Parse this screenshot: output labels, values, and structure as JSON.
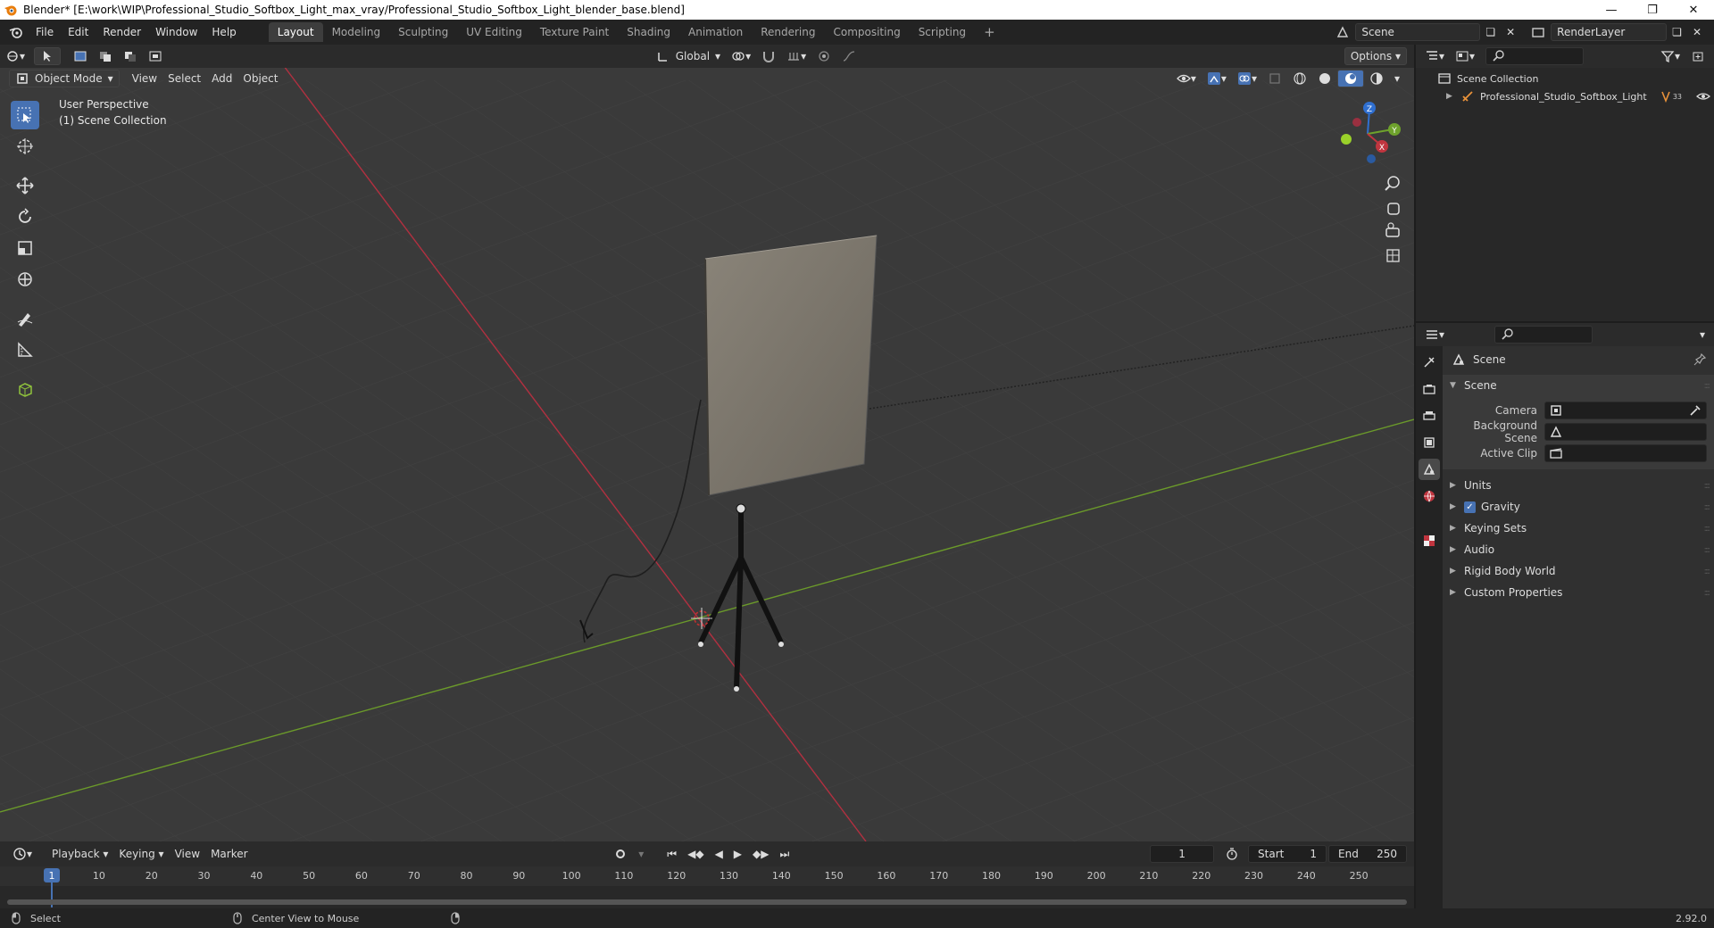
{
  "window": {
    "title": "Blender* [E:\\work\\WIP\\Professional_Studio_Softbox_Light_max_vray/Professional_Studio_Softbox_Light_blender_base.blend]"
  },
  "menu": [
    "File",
    "Edit",
    "Render",
    "Window",
    "Help"
  ],
  "workspaces": [
    {
      "label": "Layout",
      "active": true
    },
    {
      "label": "Modeling"
    },
    {
      "label": "Sculpting"
    },
    {
      "label": "UV Editing"
    },
    {
      "label": "Texture Paint"
    },
    {
      "label": "Shading"
    },
    {
      "label": "Animation"
    },
    {
      "label": "Rendering"
    },
    {
      "label": "Compositing"
    },
    {
      "label": "Scripting"
    }
  ],
  "scene_selector": {
    "value": "Scene"
  },
  "renderlayer_selector": {
    "value": "RenderLayer"
  },
  "viewport": {
    "mode": "Object Mode",
    "menus": [
      "View",
      "Select",
      "Add",
      "Object"
    ],
    "transform_orientation": "Global",
    "options_label": "Options",
    "overlay_line1": "User Perspective",
    "overlay_line2": "(1) Scene Collection",
    "gizmo": {
      "z": "Z",
      "y": "Y",
      "x": "X"
    }
  },
  "outliner": {
    "root": "Scene Collection",
    "items": [
      {
        "label": "Professional_Studio_Softbox_Light",
        "badge": "33"
      }
    ]
  },
  "properties": {
    "context_title": "Scene",
    "panel_title": "Scene",
    "rows": [
      {
        "label": "Camera"
      },
      {
        "label": "Background Scene"
      },
      {
        "label": "Active Clip"
      }
    ],
    "subpanels": [
      "Units",
      "Gravity",
      "Keying Sets",
      "Audio",
      "Rigid Body World",
      "Custom Properties"
    ]
  },
  "timeline": {
    "menus": [
      "Playback",
      "Keying",
      "View",
      "Marker"
    ],
    "current_frame": "1",
    "start_label": "Start",
    "start": "1",
    "end_label": "End",
    "end": "250",
    "ticks": [
      "1",
      "10",
      "20",
      "30",
      "40",
      "50",
      "60",
      "70",
      "80",
      "90",
      "100",
      "110",
      "120",
      "130",
      "140",
      "150",
      "160",
      "170",
      "180",
      "190",
      "200",
      "210",
      "220",
      "230",
      "240",
      "250"
    ]
  },
  "status": {
    "left": "Select",
    "middle": "Center View to Mouse",
    "version": "2.92.0"
  },
  "colors": {
    "accent": "#4772b3",
    "x_axis": "#c0353f",
    "y_axis": "#6ea22c",
    "z_axis": "#2f6fd0"
  }
}
